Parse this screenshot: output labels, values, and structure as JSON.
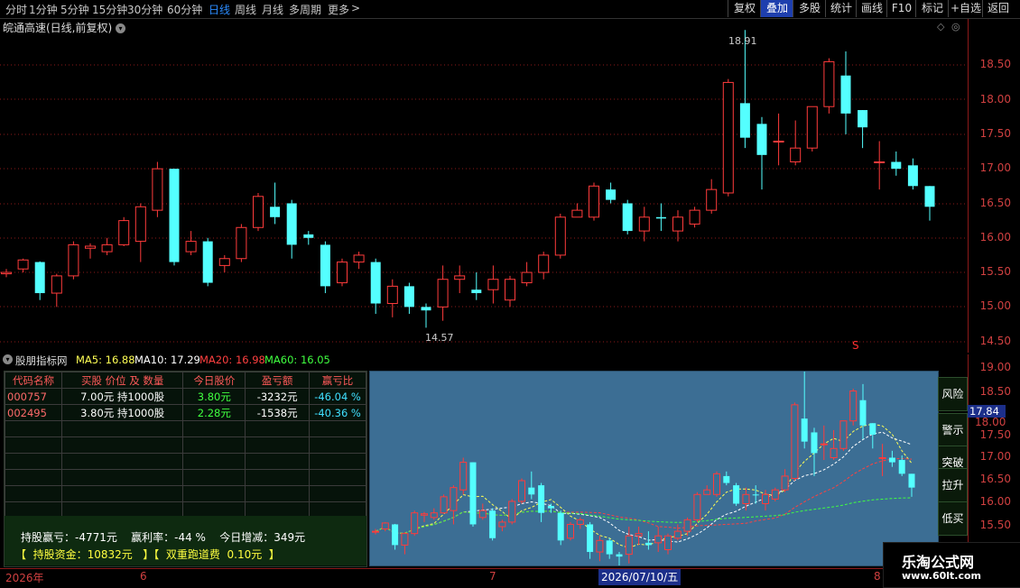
{
  "toolbar": {
    "periods": [
      "分时",
      "1分钟",
      "5分钟",
      "15分钟",
      "30分钟",
      "60分钟",
      "日线",
      "周线",
      "月线",
      "多周期",
      "更多"
    ],
    "active_period": "日线",
    "right_buttons": [
      "复权",
      "叠加",
      "多股",
      "统计",
      "画线",
      "F10",
      "标记",
      "+自选",
      "返回"
    ],
    "active_right": "叠加"
  },
  "main_chart": {
    "title": "皖通高速(日线,前复权)",
    "high_label": "18.91",
    "low_label": "14.57",
    "axis_labels": [
      "18.50",
      "18.00",
      "17.50",
      "17.00",
      "16.50",
      "16.00",
      "15.50",
      "15.00",
      "14.50"
    ],
    "s_marker": "S"
  },
  "indicator": {
    "name": "股朋指标网",
    "ma5": "MA5: 16.88",
    "ma10": "MA10: 17.29",
    "ma20": "MA20: 16.98",
    "ma60": "MA60: 16.05",
    "colors": {
      "ma5": "#ffff55",
      "ma10": "#ffffff",
      "ma20": "#ff4040",
      "ma60": "#40ff40"
    },
    "axis_labels": [
      "19.00",
      "18.50",
      "18.00",
      "17.50",
      "17.00",
      "16.50",
      "16.00",
      "15.50"
    ],
    "current_price": "17.84"
  },
  "holdings": {
    "headers": [
      "代码名称",
      "买股 价位 及 数量",
      "今日股价",
      "盈亏额",
      "赢亏比"
    ],
    "rows": [
      {
        "code": "000757",
        "buy": "7.00元  持1000股",
        "price": "3.80元",
        "pl": "-3232元",
        "ratio": "-46.04 %"
      },
      {
        "code": "002495",
        "buy": "3.80元  持1000股",
        "price": "2.28元",
        "pl": "-1538元",
        "ratio": "-40.36 %"
      }
    ],
    "summary_line1": "持股赢亏：-4771元    赢利率：-44 %    今日增减：349元",
    "summary_line2": "【  持股资金：10832元   】【  双重跑道费  0.10元  】"
  },
  "side_buttons": [
    "风险",
    "警示",
    "突破",
    "拉升",
    "低买"
  ],
  "date_axis": {
    "labels": [
      "2026年",
      "6",
      "7",
      "8"
    ],
    "cursor_date": "2026/07/10/五"
  },
  "watermark": {
    "title": "乐淘公式网",
    "url": "www.60lt.com"
  }
}
